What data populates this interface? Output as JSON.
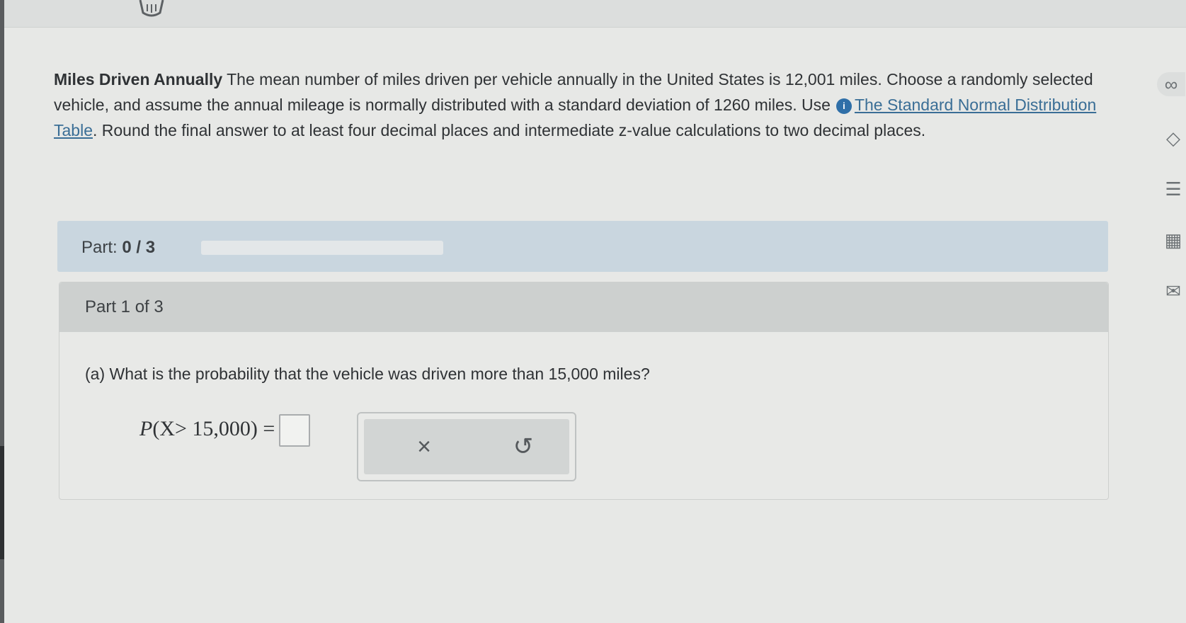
{
  "problem": {
    "title": "Miles Driven Annually",
    "text_1": " The mean number of miles driven per vehicle annually in the United States is 12,001 miles. Choose a randomly selected vehicle, and assume the annual mileage is normally distributed with a standard deviation of 1260 miles. Use",
    "link_text": "The Standard Normal Distribution Table",
    "text_2": ". Round the final answer to at least four decimal places and intermediate z-value calculations to two decimal places.",
    "info_glyph": "i"
  },
  "progress": {
    "label": "Part:",
    "value": "0 / 3",
    "fraction": 0
  },
  "part_card": {
    "header": "Part 1 of 3",
    "question": "(a) What is the probability that the vehicle was driven more than 15,000 miles?",
    "formula_p": "P",
    "formula_rest": "(X> 15,000) =",
    "answer_value": ""
  },
  "tools": {
    "clear_icon": "×",
    "undo_icon": "↺"
  },
  "side_icons": [
    "infinity-icon",
    "tag-icon",
    "notes-icon",
    "calculator-icon",
    "mail-icon"
  ],
  "side_glyphs": [
    "∞",
    "◇",
    "☰",
    "▦",
    "✉"
  ]
}
